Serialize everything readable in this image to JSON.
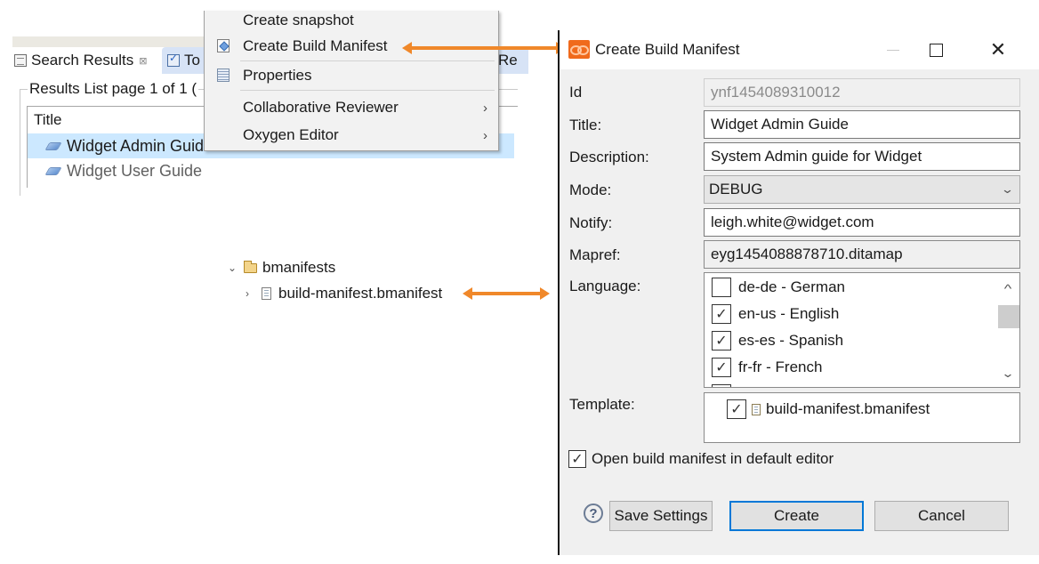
{
  "search_panel": {
    "tabs": [
      {
        "label": "Search Results",
        "icon": "search-results-icon",
        "close": "⊠"
      },
      {
        "label": "To",
        "icon": "task-list-icon"
      },
      {
        "label": "Re"
      }
    ],
    "results_legend": "Results List page 1 of 1 (",
    "column_header": "Title",
    "rows": [
      {
        "title": "Widget Admin Guide",
        "icon": "book-icon",
        "selected": true
      },
      {
        "title": "Widget User Guide",
        "icon": "book-icon",
        "selected": false
      }
    ]
  },
  "context_menu": {
    "items": [
      {
        "label": "Create snapshot"
      },
      {
        "label": "Create Build Manifest",
        "icon": "build-manifest-icon"
      },
      {
        "label": "Properties",
        "icon": "properties-icon"
      },
      {
        "label": "Collaborative Reviewer",
        "submenu": "›"
      },
      {
        "label": "Oxygen Editor",
        "submenu": "›"
      }
    ]
  },
  "project_tree": {
    "folder": {
      "label": "bmanifests",
      "expanded": true,
      "chevron": "⌄"
    },
    "file": {
      "label": "build-manifest.bmanifest",
      "chevron": "›"
    }
  },
  "annotation_colors": {
    "arrow": "#f0882a"
  },
  "dialog": {
    "title": "Create Build Manifest",
    "window_controls": {
      "minimize": "—",
      "maximize": "☐",
      "close": "✕"
    },
    "fields": {
      "id": {
        "label": "Id",
        "value": "ynf1454089310012"
      },
      "title": {
        "label": "Title:",
        "value": "Widget Admin Guide"
      },
      "description": {
        "label": "Description:",
        "value": "System Admin guide for Widget"
      },
      "mode": {
        "label": "Mode:",
        "value": "DEBUG"
      },
      "notify": {
        "label": "Notify:",
        "value": "leigh.white@widget.com"
      },
      "mapref": {
        "label": "Mapref:",
        "value": "eyg1454088878710.ditamap"
      },
      "language": {
        "label": "Language:",
        "options": [
          {
            "label": "de-de - German",
            "checked": false
          },
          {
            "label": "en-us - English",
            "checked": true
          },
          {
            "label": "es-es - Spanish",
            "checked": true
          },
          {
            "label": "fr-fr - French",
            "checked": true
          }
        ]
      },
      "template": {
        "label": "Template:",
        "items": [
          {
            "label": "build-manifest.bmanifest",
            "checked": true
          }
        ]
      }
    },
    "open_in_editor": {
      "label": "Open build manifest in default editor",
      "checked": true
    },
    "check_mark": "✓",
    "help_glyph": "?",
    "scroll_up": "^",
    "scroll_down": "⌄",
    "select_chevron": "⌄",
    "buttons": {
      "save_settings": "Save Settings",
      "create": "Create",
      "cancel": "Cancel"
    },
    "accent_color": "#0078d7"
  }
}
